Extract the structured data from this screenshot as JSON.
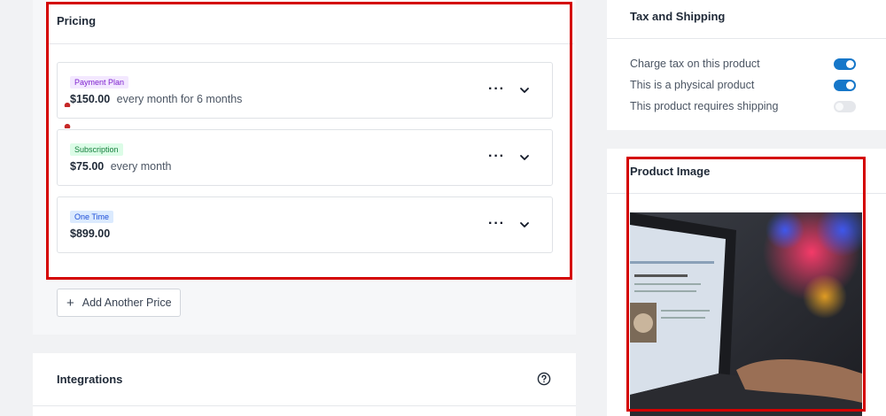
{
  "pricing": {
    "title": "Pricing",
    "prices": [
      {
        "badge": "Payment Plan",
        "badge_color": "#7e22ce",
        "amount": "$150.00",
        "desc": "every month for 6 months"
      },
      {
        "badge": "Subscription",
        "badge_color": "#15803d",
        "amount": "$75.00",
        "desc": "every month"
      },
      {
        "badge": "One Time",
        "badge_color": "#1d4ed8",
        "amount": "$899.00",
        "desc": ""
      }
    ],
    "add_button_label": "Add Another Price",
    "row_menu_icon": "more-horizontal-icon",
    "row_expand_icon": "chevron-down-icon"
  },
  "integrations": {
    "title": "Integrations",
    "help_icon": "help-circle-icon"
  },
  "tax_shipping": {
    "title": "Tax and Shipping",
    "options": [
      {
        "label": "Charge tax on this product",
        "enabled": true
      },
      {
        "label": "This is a physical product",
        "enabled": true
      },
      {
        "label": "This product requires shipping",
        "enabled": false
      }
    ],
    "toggle_on_color": "#1677c9"
  },
  "product_image": {
    "title": "Product Image"
  },
  "highlight_color": "#d40000"
}
